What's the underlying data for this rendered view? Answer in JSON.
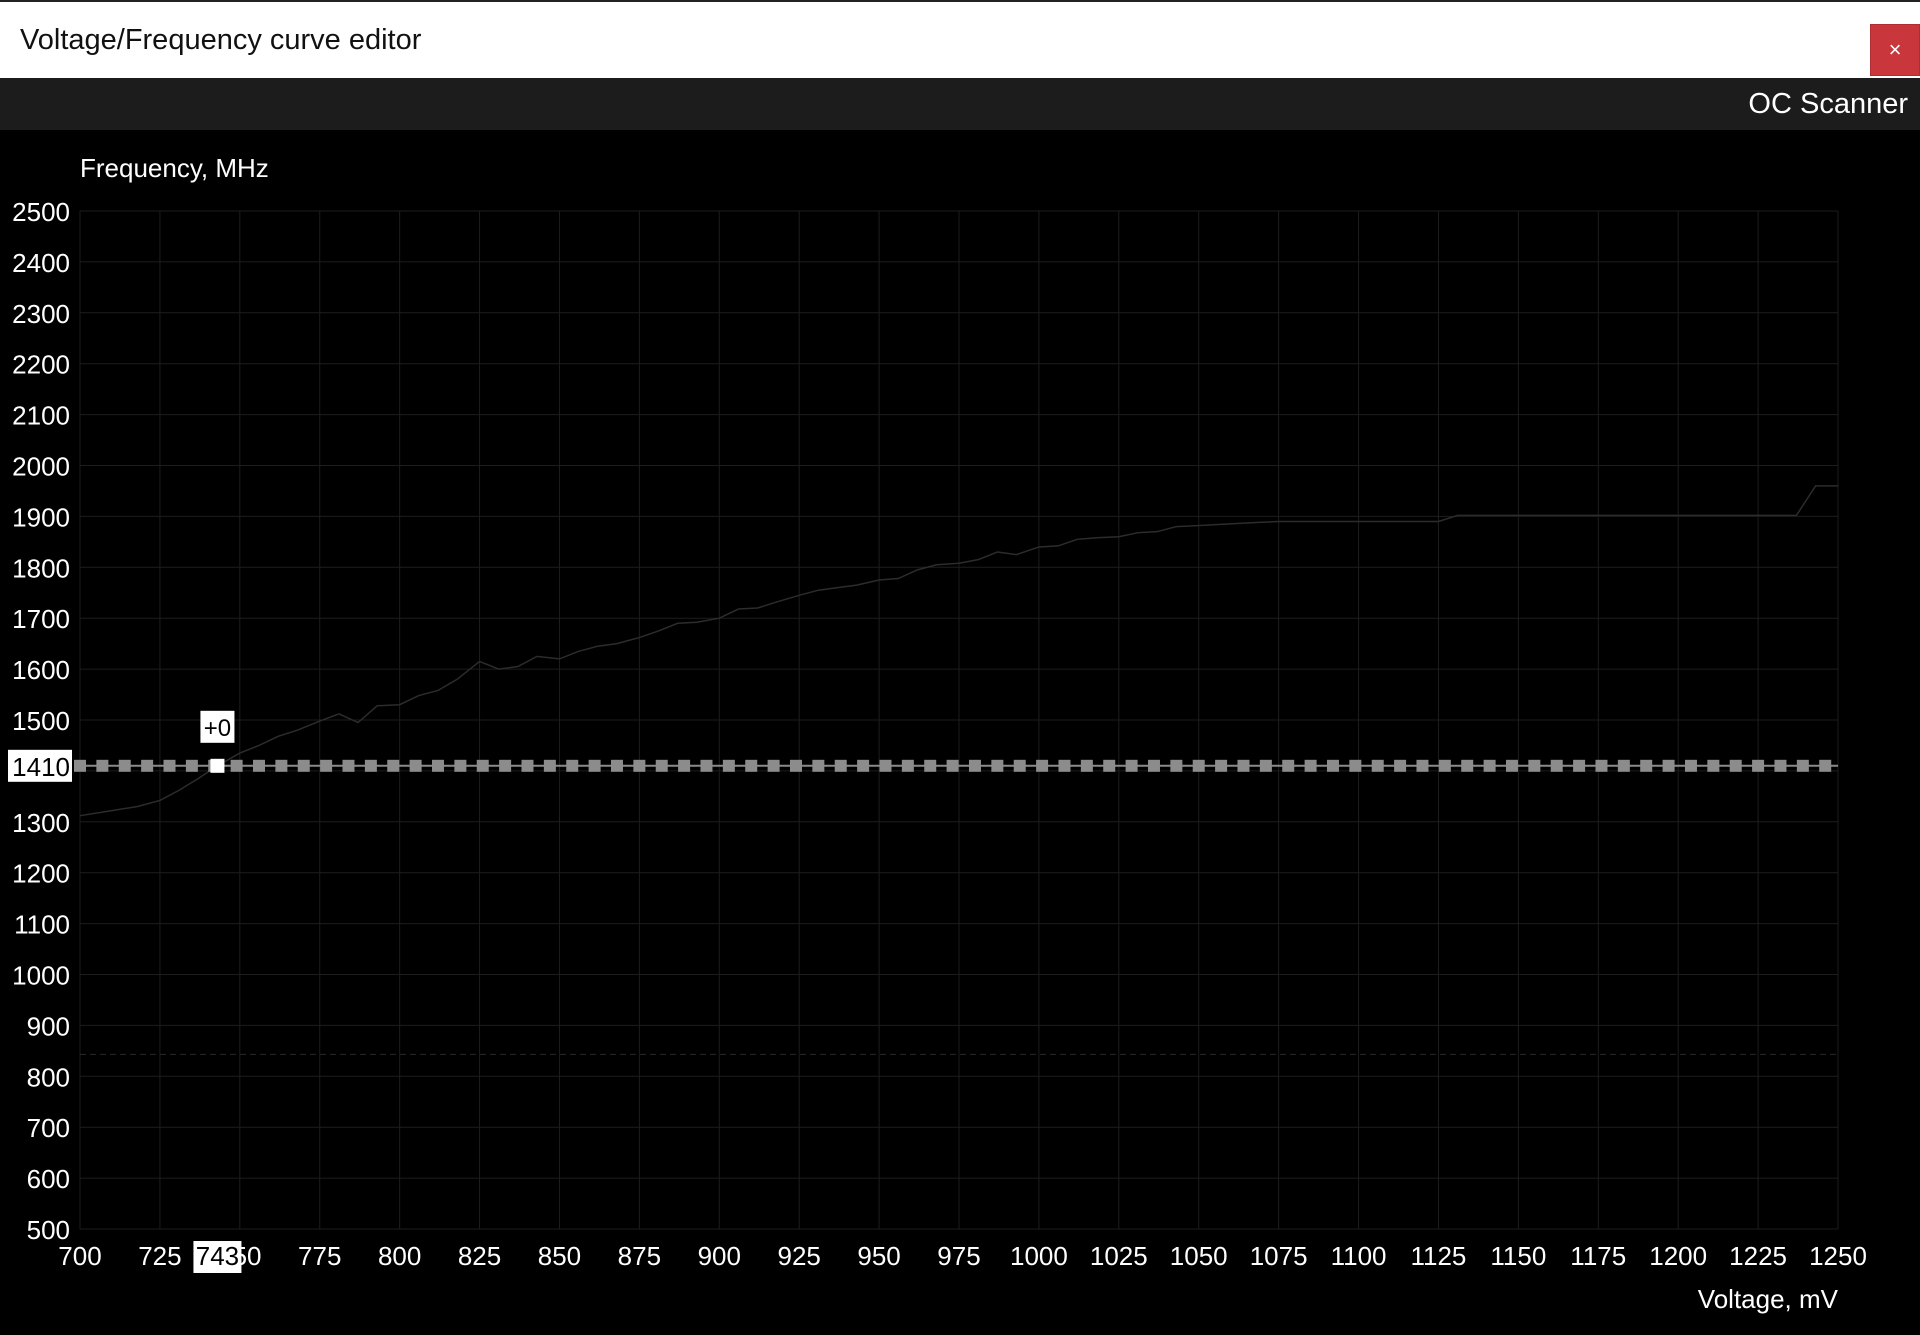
{
  "window": {
    "title": "Voltage/Frequency curve editor",
    "close_label": "×"
  },
  "toolbar": {
    "oc_scanner_label": "OC Scanner"
  },
  "chart_data": {
    "type": "line",
    "ylabel": "Frequency, MHz",
    "xlabel": "Voltage, mV",
    "xlim": [
      700,
      1250
    ],
    "ylim": [
      500,
      2500
    ],
    "x_ticks": [
      700,
      725,
      750,
      775,
      800,
      825,
      850,
      875,
      900,
      925,
      950,
      975,
      1000,
      1025,
      1050,
      1075,
      1100,
      1125,
      1150,
      1175,
      1200,
      1225,
      1250
    ],
    "y_ticks": [
      500,
      600,
      700,
      800,
      900,
      1000,
      1100,
      1200,
      1300,
      1400,
      1500,
      1600,
      1700,
      1800,
      1900,
      2000,
      2100,
      2200,
      2300,
      2400,
      2500
    ],
    "grid": true,
    "series": [
      {
        "x": [
          700,
          710,
          718,
          725,
          731,
          737,
          743,
          750,
          756,
          762,
          768,
          775,
          781,
          787,
          793,
          800,
          806,
          812,
          818,
          825,
          831,
          837,
          843,
          850,
          856,
          862,
          868,
          875,
          881,
          887,
          893,
          900,
          906,
          912,
          918,
          925,
          931,
          937,
          943,
          950,
          956,
          962,
          968,
          975,
          981,
          987,
          993,
          1000,
          1006,
          1012,
          1018,
          1025,
          1031,
          1037,
          1043,
          1050,
          1056,
          1062,
          1068,
          1075,
          1100,
          1125,
          1131,
          1150,
          1175,
          1200,
          1225,
          1237,
          1243,
          1250
        ],
        "y": [
          1312,
          1322,
          1330,
          1342,
          1362,
          1385,
          1410,
          1435,
          1450,
          1468,
          1480,
          1498,
          1512,
          1495,
          1528,
          1530,
          1548,
          1558,
          1580,
          1615,
          1600,
          1605,
          1625,
          1620,
          1635,
          1645,
          1650,
          1662,
          1675,
          1690,
          1692,
          1700,
          1718,
          1720,
          1732,
          1745,
          1755,
          1760,
          1765,
          1775,
          1778,
          1795,
          1805,
          1808,
          1815,
          1830,
          1825,
          1840,
          1842,
          1855,
          1858,
          1860,
          1868,
          1870,
          1880,
          1882,
          1884,
          1886,
          1888,
          1890,
          1890,
          1890,
          1902,
          1902,
          1902,
          1902,
          1902,
          1902,
          1960,
          1960
        ]
      }
    ],
    "offset_line": {
      "y": 1410,
      "points_x_from": 700,
      "points_x_to": 1250,
      "points_x_step": 7
    },
    "selected": {
      "voltage": 743,
      "frequency": 1410,
      "offset": 0
    },
    "reference_line_y": 843,
    "labels": {
      "selected_voltage": "743",
      "selected_frequency": "1410",
      "selected_offset": "+0"
    }
  }
}
